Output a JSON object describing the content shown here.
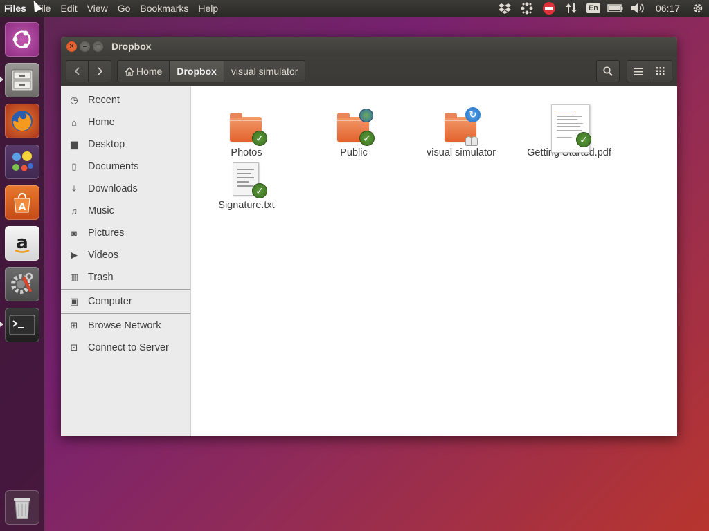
{
  "top_panel": {
    "app_name": "Files",
    "menus": [
      "File",
      "Edit",
      "View",
      "Go",
      "Bookmarks",
      "Help"
    ],
    "keyboard_layout": "En",
    "clock": "06:17",
    "indicators": [
      "dropbox-icon",
      "network-dots-icon",
      "dnd-icon",
      "network-transfer-icon",
      "keyboard-icon",
      "battery-icon",
      "volume-icon",
      "session-gear-icon"
    ]
  },
  "launcher": {
    "items": [
      "ubuntu-dash-icon",
      "files-app-icon",
      "firefox-icon",
      "libreoffice-icon",
      "software-center-icon",
      "amazon-icon",
      "system-settings-icon",
      "terminal-icon",
      "trash-launcher-icon"
    ]
  },
  "window": {
    "title": "Dropbox",
    "breadcrumbs": [
      "Home",
      "Dropbox",
      "visual simulator"
    ],
    "active_crumb": "Dropbox"
  },
  "sidebar": {
    "items": [
      {
        "label": "Recent",
        "icon": "clock-icon"
      },
      {
        "label": "Home",
        "icon": "home-icon"
      },
      {
        "label": "Desktop",
        "icon": "folder-icon"
      },
      {
        "label": "Documents",
        "icon": "document-icon"
      },
      {
        "label": "Downloads",
        "icon": "download-icon"
      },
      {
        "label": "Music",
        "icon": "music-icon"
      },
      {
        "label": "Pictures",
        "icon": "camera-icon"
      },
      {
        "label": "Videos",
        "icon": "video-icon"
      },
      {
        "label": "Trash",
        "icon": "trash-icon"
      }
    ],
    "devices": [
      {
        "label": "Computer",
        "icon": "computer-icon"
      }
    ],
    "network": [
      {
        "label": "Browse Network",
        "icon": "network-icon"
      },
      {
        "label": "Connect to Server",
        "icon": "server-icon"
      }
    ]
  },
  "files": [
    {
      "name": "Photos",
      "type": "folder",
      "synced": true
    },
    {
      "name": "Public",
      "type": "folder-public",
      "synced": true
    },
    {
      "name": "visual simulator",
      "type": "folder-shared",
      "synced": false
    },
    {
      "name": "Getting Started.pdf",
      "type": "pdf",
      "synced": true
    },
    {
      "name": "Signature.txt",
      "type": "text",
      "synced": true
    }
  ],
  "colors": {
    "accent_orange": "#e2622d",
    "sync_green": "#3a7020",
    "panel": "#3c3b37"
  }
}
